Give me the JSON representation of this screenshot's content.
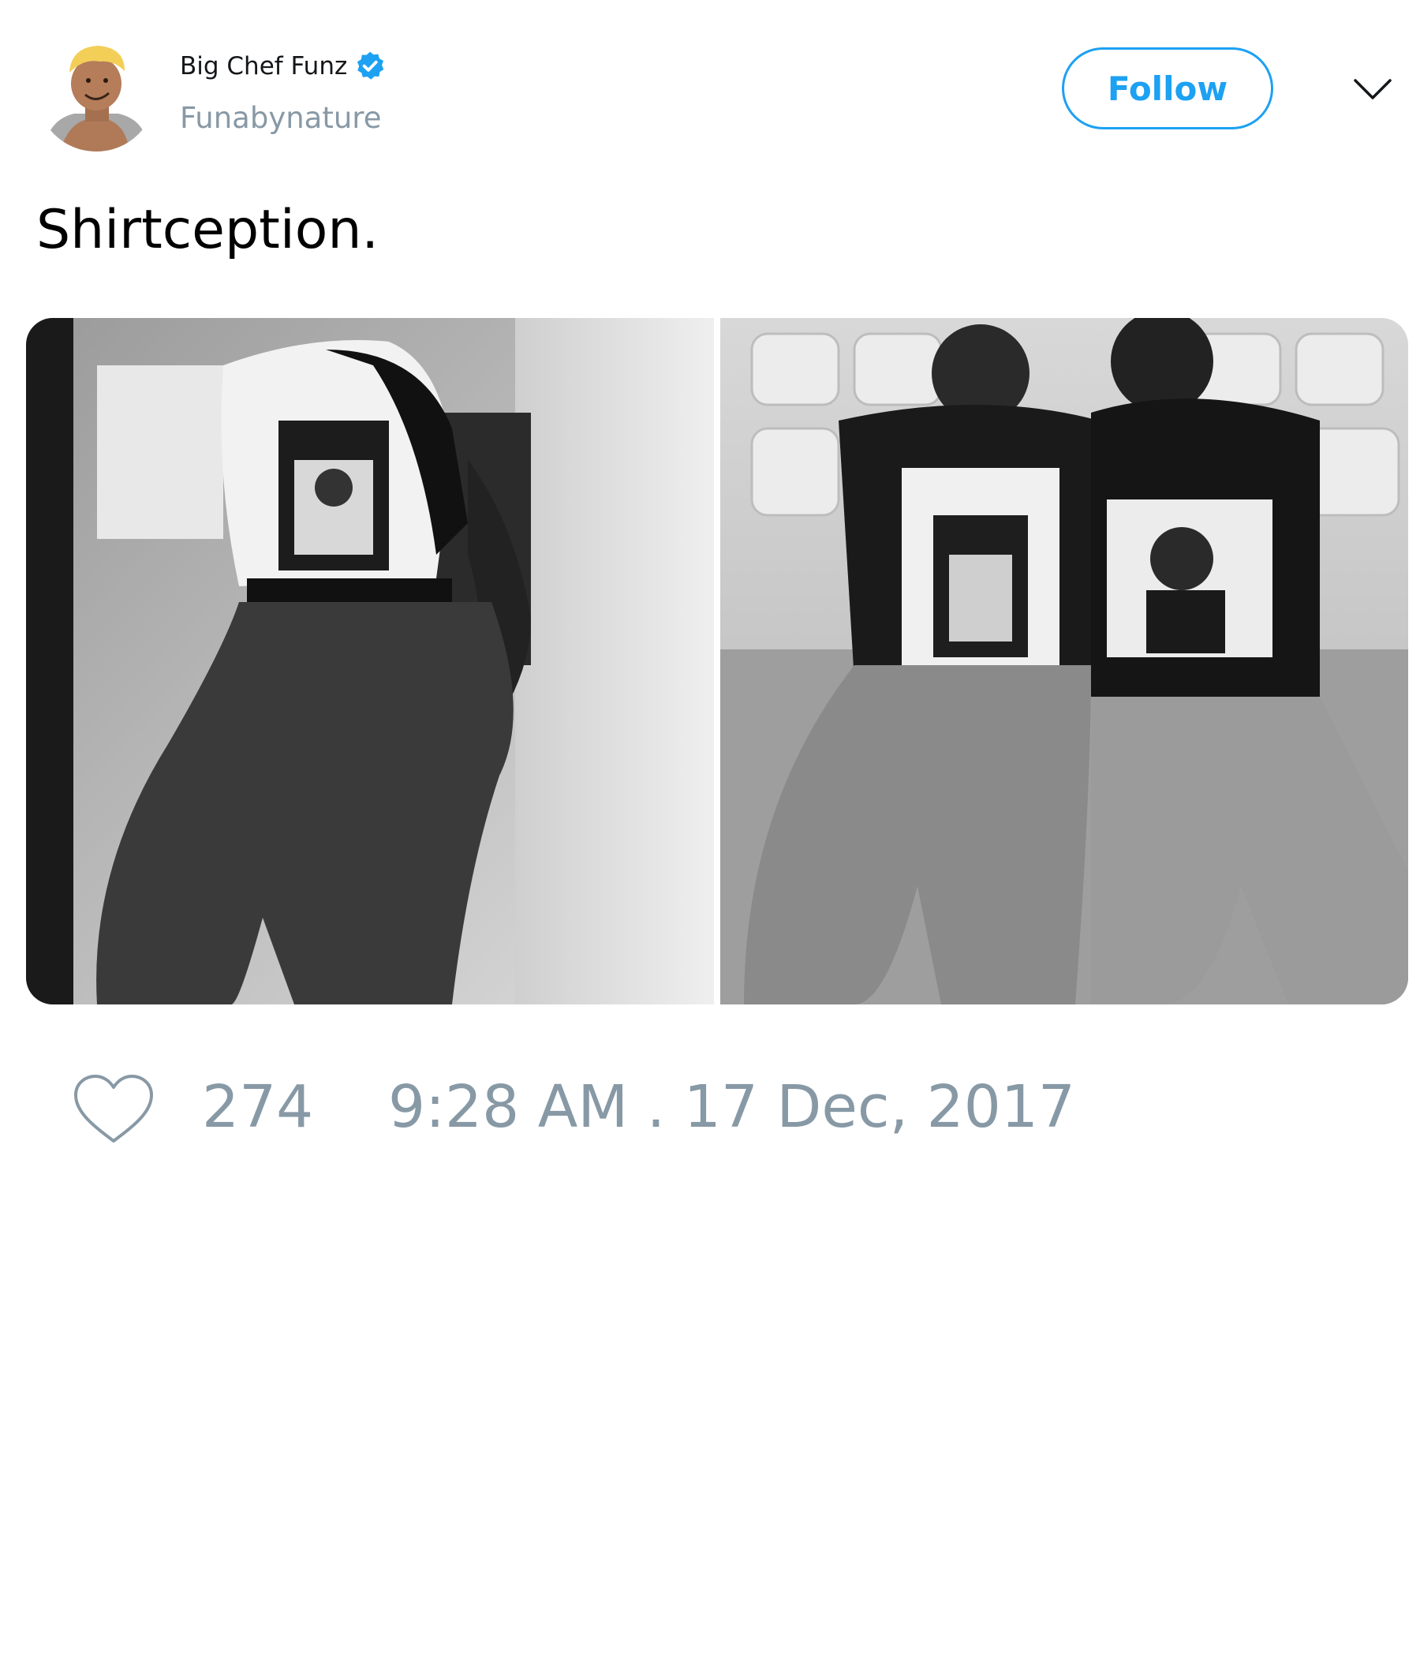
{
  "author": {
    "display_name": "Big Chef Funz",
    "handle": "Funabynature",
    "verified": true,
    "avatar_icon": "cartoon-avatar"
  },
  "actions": {
    "follow_label": "Follow",
    "menu_icon": "chevron-down-icon"
  },
  "tweet": {
    "text": "Shirtception.",
    "media": [
      {
        "description_icon": "photo"
      },
      {
        "description_icon": "photo"
      }
    ]
  },
  "footer": {
    "like_icon": "heart-icon",
    "like_count": "274",
    "timestamp": "9:28 AM . 17 Dec, 2017"
  },
  "colors": {
    "accent": "#1da1f2",
    "secondary_text": "#8899a6",
    "primary_text": "#14171a"
  }
}
